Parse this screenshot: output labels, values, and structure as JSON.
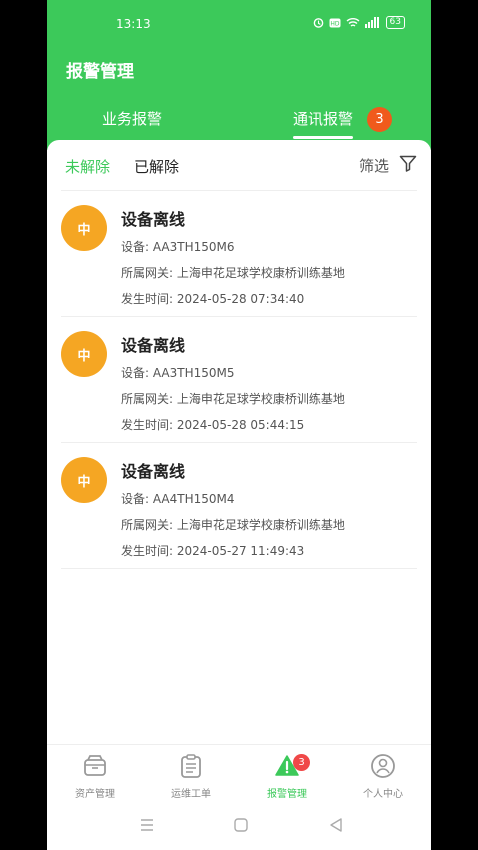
{
  "status_bar": {
    "time": "13:13",
    "battery": "63"
  },
  "header": {
    "title": "报警管理",
    "tabs": [
      {
        "label": "业务报警"
      },
      {
        "label": "通讯报警",
        "badge": "3"
      }
    ]
  },
  "filter": {
    "segments": [
      "未解除",
      "已解除"
    ],
    "filter_label": "筛选"
  },
  "alarms": [
    {
      "level": "中",
      "title": "设备离线",
      "device": "设备:  AA3TH150M6",
      "gateway": "所属网关:  上海申花足球学校康桥训练基地",
      "time": "发生时间:  2024-05-28 07:34:40"
    },
    {
      "level": "中",
      "title": "设备离线",
      "device": "设备:  AA3TH150M5",
      "gateway": "所属网关:  上海申花足球学校康桥训练基地",
      "time": "发生时间:  2024-05-28 05:44:15"
    },
    {
      "level": "中",
      "title": "设备离线",
      "device": "设备:  AA4TH150M4",
      "gateway": "所属网关:  上海申花足球学校康桥训练基地",
      "time": "发生时间:  2024-05-27 11:49:43"
    }
  ],
  "bottom_nav": {
    "items": [
      {
        "label": "资产管理",
        "icon": "asset-box-icon"
      },
      {
        "label": "运维工单",
        "icon": "clipboard-icon"
      },
      {
        "label": "报警管理",
        "icon": "warning-triangle-icon",
        "badge": "3"
      },
      {
        "label": "个人中心",
        "icon": "user-circle-icon"
      }
    ]
  },
  "colors": {
    "primary": "#3cc95a",
    "level_medium": "#f5a623",
    "badge": "#f05a1c"
  }
}
